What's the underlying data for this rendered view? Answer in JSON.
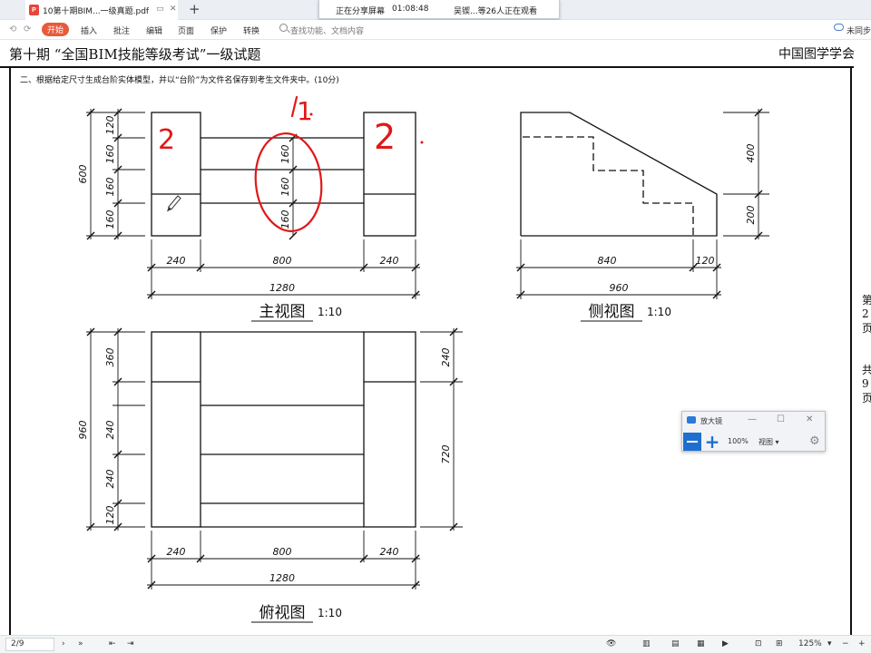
{
  "tabbar": {
    "tab_icon": "pdf-file-icon",
    "tab_icon_text": "P",
    "tab_title": "10第十期BIM...一级真题.pdf",
    "share_status": "正在分享屏幕",
    "share_time": "01:08:48",
    "viewers": "吴锲...等26人正在观看"
  },
  "toolbar": {
    "start": "开始",
    "insert": "插入",
    "annotate": "批注",
    "edit": "编辑",
    "page": "页面",
    "protect": "保护",
    "convert": "转换",
    "search_placeholder": "查找功能、文档内容",
    "sync": "未同步"
  },
  "document": {
    "header_left": "第十期 “全国BIM技能等级考试”一级试题",
    "header_right": "中国图学学会",
    "question": "二、根据给定尺寸生成台阶实体模型，并以“台阶”为文件名保存到考生文件夹中。(10分)",
    "side_note_1": [
      "第",
      "2",
      "页"
    ],
    "side_note_2": [
      "共",
      "9",
      "页"
    ],
    "views": {
      "front_title": "主视图",
      "side_title": "侧视图",
      "top_title": "俯视图",
      "scale": "1:10"
    },
    "dims": {
      "front_vertical": [
        "120",
        "160",
        "160",
        "160"
      ],
      "front_total": "600",
      "front_inner": [
        "160",
        "160",
        "160"
      ],
      "horizontal": [
        "240",
        "800",
        "240"
      ],
      "horizontal_total": "1280",
      "side_right": [
        "400",
        "200"
      ],
      "side_bottom": [
        "840",
        "120"
      ],
      "side_total": "960",
      "top_left": [
        "360",
        "240",
        "240",
        "120"
      ],
      "top_total": "960",
      "top_right": [
        "240",
        "720"
      ]
    },
    "annotations": [
      "2",
      "1",
      "2"
    ]
  },
  "magnifier": {
    "title": "放大镜",
    "zoom": "100%",
    "view": "视图"
  },
  "statusbar": {
    "page": "2/9",
    "zoom": "125%"
  }
}
